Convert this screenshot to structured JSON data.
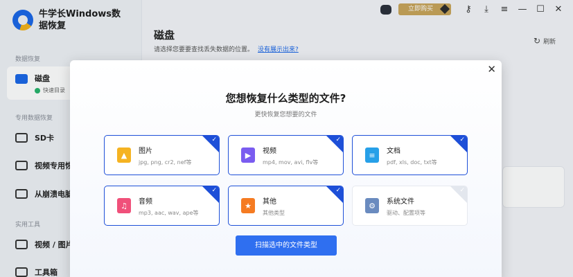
{
  "app": {
    "title": "牛学长Windows数据恢复"
  },
  "topbar": {
    "buy_label": "立即购买"
  },
  "sidebar": {
    "section_recovery": "数据恢复",
    "disk_label": "磁盘",
    "disk_sub": "快速目录",
    "section_special": "专用数据恢复",
    "sd_label": "SD卡",
    "video_label": "视频专用恢",
    "crash_label": "从崩溃电脑",
    "section_tools": "实用工具",
    "video_photo_label": "视频 / 图片",
    "toolbox_label": "工具箱"
  },
  "main": {
    "title": "磁盘",
    "subtitle": "请选择您要要查找丢失数据的位置。",
    "link": "没有展示出来?",
    "refresh_label": "刷新"
  },
  "dialog": {
    "title": "您想恢复什么类型的文件?",
    "subtitle": "更快恢复您想要的文件",
    "cards": [
      {
        "name": "图片",
        "exts": "jpg, png, cr2, nef等",
        "color": "#f5b322",
        "icon": "image-icon",
        "selected": true
      },
      {
        "name": "视频",
        "exts": "mp4, mov, avi, flv等",
        "color": "#7a5cf0",
        "icon": "video-icon",
        "selected": true
      },
      {
        "name": "文档",
        "exts": "pdf, xls, doc, txt等",
        "color": "#27a0e8",
        "icon": "document-icon",
        "selected": true
      },
      {
        "name": "音频",
        "exts": "mp3, aac, wav, ape等",
        "color": "#f0507a",
        "icon": "audio-icon",
        "selected": true
      },
      {
        "name": "其他",
        "exts": "其他类型",
        "color": "#f57b22",
        "icon": "star-icon",
        "selected": true
      },
      {
        "name": "系统文件",
        "exts": "驱动、配置项等",
        "color": "#6a8bbf",
        "icon": "gear-icon",
        "selected": false
      }
    ],
    "scan_label": "扫描选中的文件类型"
  }
}
